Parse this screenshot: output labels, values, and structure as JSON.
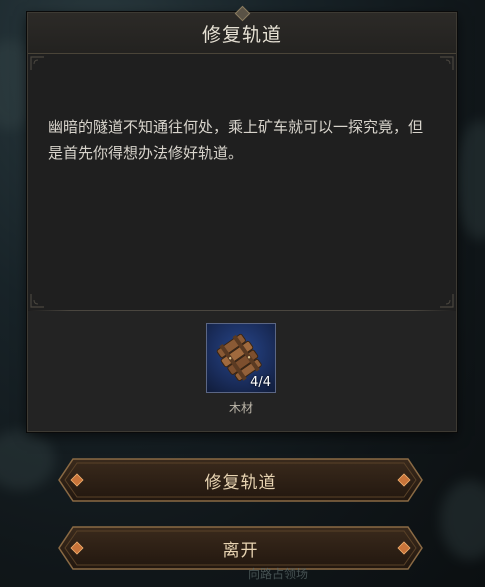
{
  "dialog": {
    "title": "修复轨道",
    "description": "幽暗的隧道不知通往何处，乘上矿车就可以一探究竟，但是首先你得想办法修好轨道。"
  },
  "reward": {
    "item_icon": "wood-planks-icon",
    "count": "4/4",
    "name": "木材",
    "slot_color": "#1a2d5c"
  },
  "actions": {
    "repair_label": "修复轨道",
    "leave_label": "离开"
  },
  "background_text": "向路占领场",
  "colors": {
    "accent": "#c8743a",
    "button_border": "#8a6a44",
    "title_text": "#e6e1d4"
  }
}
